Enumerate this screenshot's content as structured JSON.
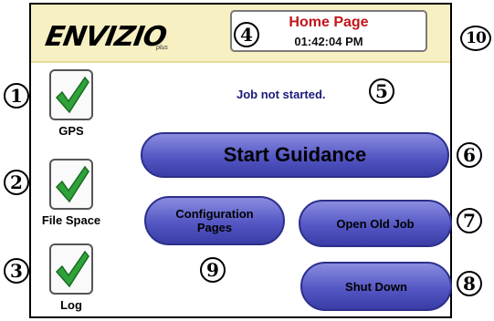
{
  "header": {
    "logo": "ENVIZIO",
    "logo_sub": "plus",
    "title": "Home Page",
    "time": "01:42:04 PM"
  },
  "status_indicators": [
    {
      "label": "GPS",
      "icon": "check-icon",
      "state": "ok"
    },
    {
      "label": "File Space",
      "icon": "check-icon",
      "state": "ok"
    },
    {
      "label": "Log",
      "icon": "check-icon",
      "state": "ok"
    }
  ],
  "job_status": "Job not started.",
  "buttons": {
    "start_guidance": "Start Guidance",
    "configuration_pages": "Configuration Pages",
    "open_old_job": "Open Old Job",
    "shut_down": "Shut Down"
  },
  "callouts": [
    "1",
    "2",
    "3",
    "4",
    "5",
    "6",
    "7",
    "8",
    "9",
    "10"
  ],
  "colors": {
    "header_bg": "#f7f0c2",
    "title_red": "#c0161b",
    "button_blue": "#5457c4",
    "check_green": "#2fa33a"
  }
}
